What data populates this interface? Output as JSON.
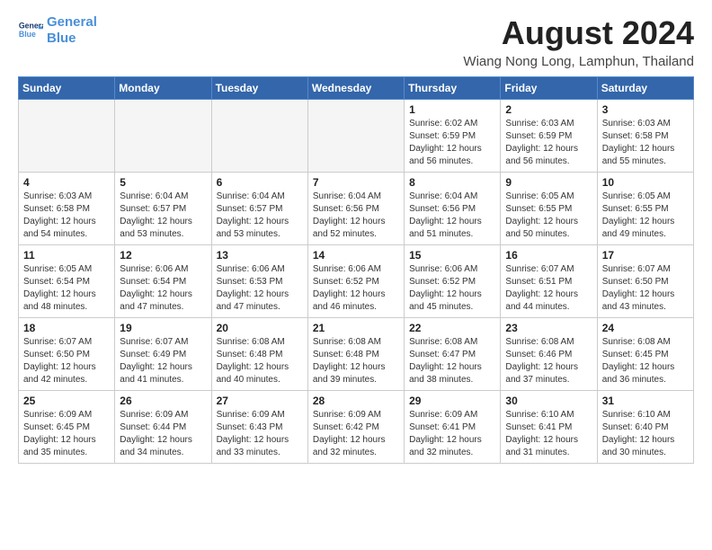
{
  "logo": {
    "line1": "General",
    "line2": "Blue"
  },
  "title": "August 2024",
  "subtitle": "Wiang Nong Long, Lamphun, Thailand",
  "weekdays": [
    "Sunday",
    "Monday",
    "Tuesday",
    "Wednesday",
    "Thursday",
    "Friday",
    "Saturday"
  ],
  "weeks": [
    [
      {
        "day": "",
        "info": ""
      },
      {
        "day": "",
        "info": ""
      },
      {
        "day": "",
        "info": ""
      },
      {
        "day": "",
        "info": ""
      },
      {
        "day": "1",
        "info": "Sunrise: 6:02 AM\nSunset: 6:59 PM\nDaylight: 12 hours\nand 56 minutes."
      },
      {
        "day": "2",
        "info": "Sunrise: 6:03 AM\nSunset: 6:59 PM\nDaylight: 12 hours\nand 56 minutes."
      },
      {
        "day": "3",
        "info": "Sunrise: 6:03 AM\nSunset: 6:58 PM\nDaylight: 12 hours\nand 55 minutes."
      }
    ],
    [
      {
        "day": "4",
        "info": "Sunrise: 6:03 AM\nSunset: 6:58 PM\nDaylight: 12 hours\nand 54 minutes."
      },
      {
        "day": "5",
        "info": "Sunrise: 6:04 AM\nSunset: 6:57 PM\nDaylight: 12 hours\nand 53 minutes."
      },
      {
        "day": "6",
        "info": "Sunrise: 6:04 AM\nSunset: 6:57 PM\nDaylight: 12 hours\nand 53 minutes."
      },
      {
        "day": "7",
        "info": "Sunrise: 6:04 AM\nSunset: 6:56 PM\nDaylight: 12 hours\nand 52 minutes."
      },
      {
        "day": "8",
        "info": "Sunrise: 6:04 AM\nSunset: 6:56 PM\nDaylight: 12 hours\nand 51 minutes."
      },
      {
        "day": "9",
        "info": "Sunrise: 6:05 AM\nSunset: 6:55 PM\nDaylight: 12 hours\nand 50 minutes."
      },
      {
        "day": "10",
        "info": "Sunrise: 6:05 AM\nSunset: 6:55 PM\nDaylight: 12 hours\nand 49 minutes."
      }
    ],
    [
      {
        "day": "11",
        "info": "Sunrise: 6:05 AM\nSunset: 6:54 PM\nDaylight: 12 hours\nand 48 minutes."
      },
      {
        "day": "12",
        "info": "Sunrise: 6:06 AM\nSunset: 6:54 PM\nDaylight: 12 hours\nand 47 minutes."
      },
      {
        "day": "13",
        "info": "Sunrise: 6:06 AM\nSunset: 6:53 PM\nDaylight: 12 hours\nand 47 minutes."
      },
      {
        "day": "14",
        "info": "Sunrise: 6:06 AM\nSunset: 6:52 PM\nDaylight: 12 hours\nand 46 minutes."
      },
      {
        "day": "15",
        "info": "Sunrise: 6:06 AM\nSunset: 6:52 PM\nDaylight: 12 hours\nand 45 minutes."
      },
      {
        "day": "16",
        "info": "Sunrise: 6:07 AM\nSunset: 6:51 PM\nDaylight: 12 hours\nand 44 minutes."
      },
      {
        "day": "17",
        "info": "Sunrise: 6:07 AM\nSunset: 6:50 PM\nDaylight: 12 hours\nand 43 minutes."
      }
    ],
    [
      {
        "day": "18",
        "info": "Sunrise: 6:07 AM\nSunset: 6:50 PM\nDaylight: 12 hours\nand 42 minutes."
      },
      {
        "day": "19",
        "info": "Sunrise: 6:07 AM\nSunset: 6:49 PM\nDaylight: 12 hours\nand 41 minutes."
      },
      {
        "day": "20",
        "info": "Sunrise: 6:08 AM\nSunset: 6:48 PM\nDaylight: 12 hours\nand 40 minutes."
      },
      {
        "day": "21",
        "info": "Sunrise: 6:08 AM\nSunset: 6:48 PM\nDaylight: 12 hours\nand 39 minutes."
      },
      {
        "day": "22",
        "info": "Sunrise: 6:08 AM\nSunset: 6:47 PM\nDaylight: 12 hours\nand 38 minutes."
      },
      {
        "day": "23",
        "info": "Sunrise: 6:08 AM\nSunset: 6:46 PM\nDaylight: 12 hours\nand 37 minutes."
      },
      {
        "day": "24",
        "info": "Sunrise: 6:08 AM\nSunset: 6:45 PM\nDaylight: 12 hours\nand 36 minutes."
      }
    ],
    [
      {
        "day": "25",
        "info": "Sunrise: 6:09 AM\nSunset: 6:45 PM\nDaylight: 12 hours\nand 35 minutes."
      },
      {
        "day": "26",
        "info": "Sunrise: 6:09 AM\nSunset: 6:44 PM\nDaylight: 12 hours\nand 34 minutes."
      },
      {
        "day": "27",
        "info": "Sunrise: 6:09 AM\nSunset: 6:43 PM\nDaylight: 12 hours\nand 33 minutes."
      },
      {
        "day": "28",
        "info": "Sunrise: 6:09 AM\nSunset: 6:42 PM\nDaylight: 12 hours\nand 32 minutes."
      },
      {
        "day": "29",
        "info": "Sunrise: 6:09 AM\nSunset: 6:41 PM\nDaylight: 12 hours\nand 32 minutes."
      },
      {
        "day": "30",
        "info": "Sunrise: 6:10 AM\nSunset: 6:41 PM\nDaylight: 12 hours\nand 31 minutes."
      },
      {
        "day": "31",
        "info": "Sunrise: 6:10 AM\nSunset: 6:40 PM\nDaylight: 12 hours\nand 30 minutes."
      }
    ]
  ]
}
